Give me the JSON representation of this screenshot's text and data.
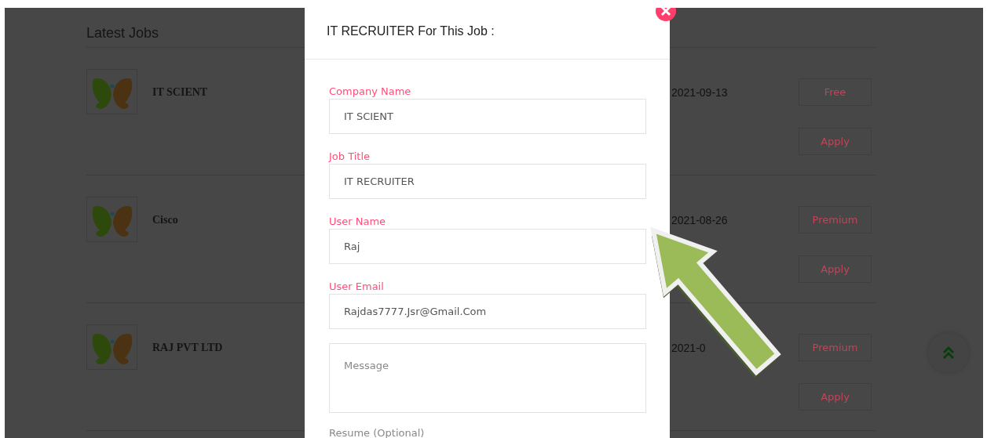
{
  "section_title": "Latest Jobs",
  "jobs": [
    {
      "company": "IT SCIENT",
      "date": "2021-09-13",
      "plan": "Free",
      "apply": "Apply"
    },
    {
      "company": "Cisco",
      "date": "2021-08-26",
      "plan": "Premium",
      "apply": "Apply"
    },
    {
      "company": "RAJ PVT LTD",
      "date": "2021-0",
      "plan": "Premium",
      "apply": "Apply"
    }
  ],
  "modal": {
    "title": "IT RECRUITER For This Job :",
    "fields": [
      {
        "kind": "input",
        "label": "Company Name",
        "value": "IT SCIENT"
      },
      {
        "kind": "input",
        "label": "Job Title",
        "value": "IT RECRUITER"
      },
      {
        "kind": "input",
        "label": "User Name",
        "value": "Raj"
      },
      {
        "kind": "input",
        "label": "User Email",
        "value": "Rajdas7777.Jsr@Gmail.Com"
      },
      {
        "kind": "textarea",
        "placeholder": "Message"
      },
      {
        "kind": "file",
        "label": "Resume (Optional)"
      }
    ]
  }
}
